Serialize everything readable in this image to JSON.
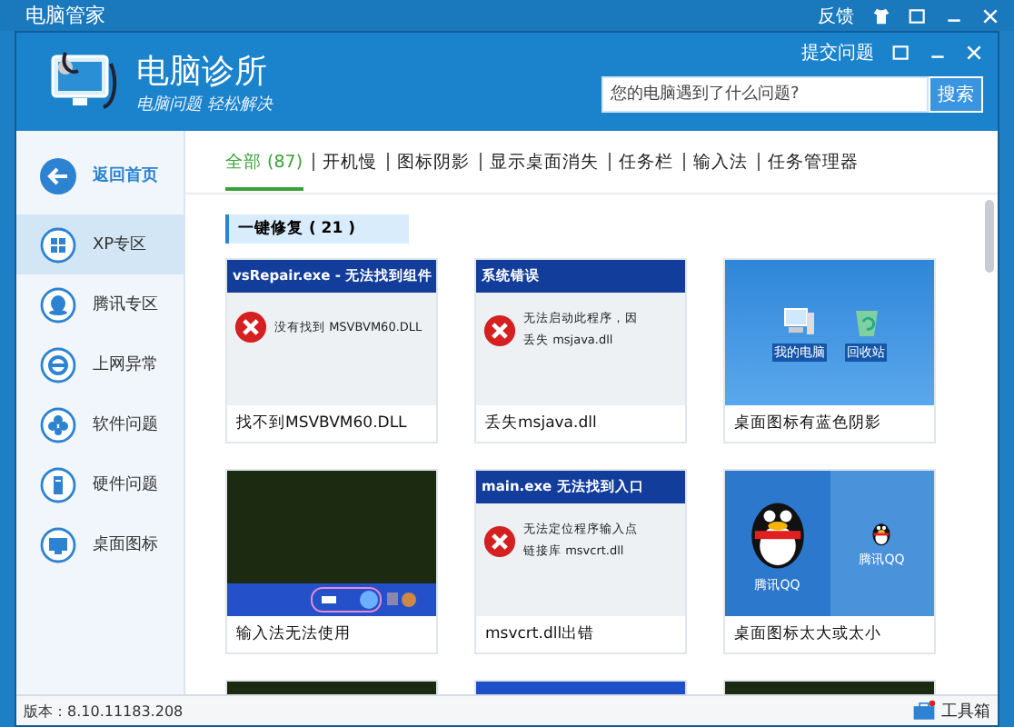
{
  "back_window": {
    "title": "电脑管家",
    "buttons": [
      "反馈"
    ]
  },
  "window": {
    "buttons": [
      "提交问题"
    ]
  },
  "app": {
    "name": "电脑诊所",
    "slogan": "电脑问题 轻松解决"
  },
  "search": {
    "placeholder": "您的电脑遇到了什么问题?",
    "button": "搜索"
  },
  "sidebar": {
    "back": "返回首页",
    "items": [
      {
        "label": "XP专区",
        "selected": true
      },
      {
        "label": "腾讯专区",
        "selected": false
      },
      {
        "label": "上网异常",
        "selected": false
      },
      {
        "label": "软件问题",
        "selected": false
      },
      {
        "label": "硬件问题",
        "selected": false
      },
      {
        "label": "桌面图标",
        "selected": false
      }
    ]
  },
  "tabs": [
    {
      "label": "全部 (87)",
      "selected": true
    },
    {
      "label": "开机慢",
      "selected": false
    },
    {
      "label": "图标阴影",
      "selected": false
    },
    {
      "label": "显示桌面消失",
      "selected": false
    },
    {
      "label": "任务栏",
      "selected": false
    },
    {
      "label": "输入法",
      "selected": false
    },
    {
      "label": "任务管理器",
      "selected": false
    }
  ],
  "section": {
    "title": "一键修复 ( 21 )"
  },
  "cards": [
    {
      "kind": "error",
      "caption": "找不到MSVBVM60.DLL",
      "dialog_title": "vsRepair.exe - 无法找到组件",
      "lines": [
        "没有找到 MSVBVM60.DLL"
      ]
    },
    {
      "kind": "error",
      "caption": "丢失msjava.dll",
      "dialog_title": "系统错误",
      "lines": [
        "无法启动此程序，因",
        "丢失 msjava.dll"
      ]
    },
    {
      "kind": "desktop",
      "caption": "桌面图标有蓝色阴影",
      "icons": [
        "我的电脑",
        "回收站"
      ]
    },
    {
      "kind": "taskbar",
      "caption": "输入法无法使用"
    },
    {
      "kind": "error",
      "caption": "msvcrt.dll出错",
      "dialog_title": "main.exe 无法找到入口",
      "lines": [
        "无法定位程序输入点",
        "链接库 msvcrt.dll"
      ]
    },
    {
      "kind": "qq",
      "caption": "桌面图标太大或太小",
      "icons": [
        "腾讯QQ",
        "腾讯QQ"
      ]
    },
    {
      "kind": "cut-dark"
    },
    {
      "kind": "cut-blue"
    },
    {
      "kind": "cut-dark"
    }
  ],
  "status": {
    "version": "版本：8.10.11183.208",
    "toolbox": "工具箱"
  }
}
